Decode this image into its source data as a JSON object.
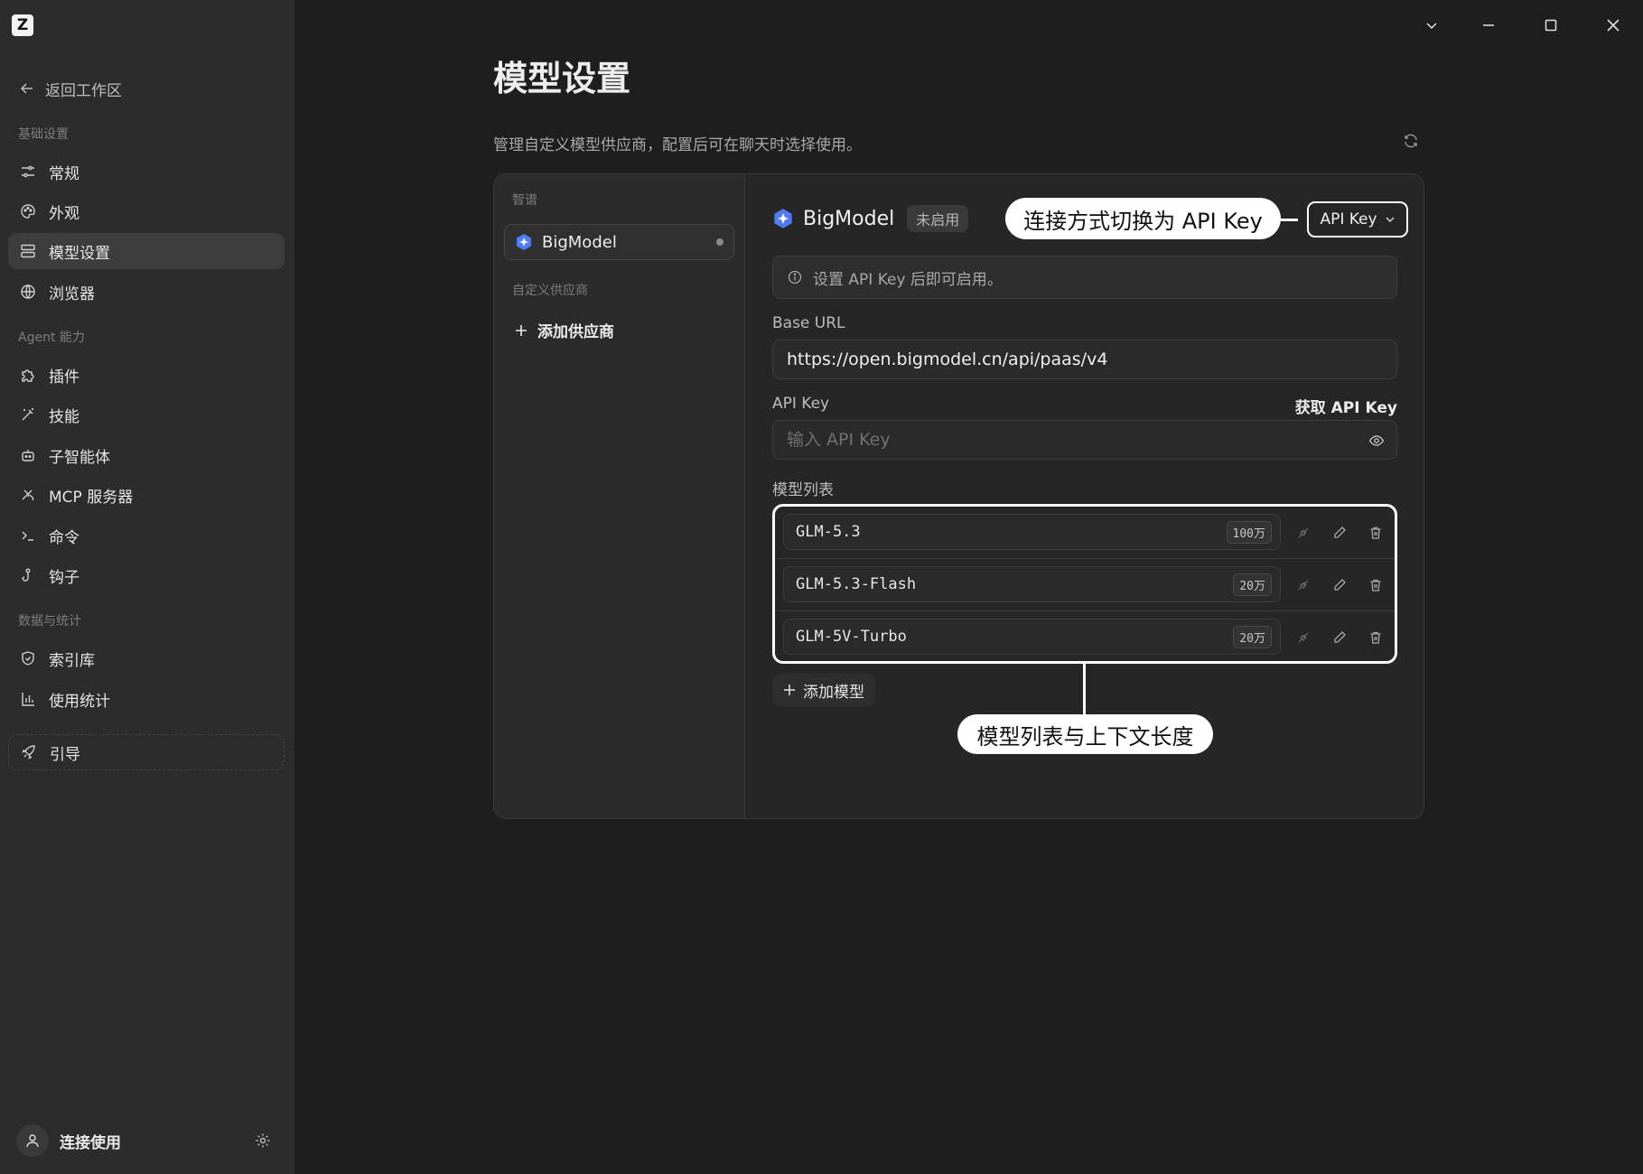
{
  "app": {
    "logo_letter": "Z"
  },
  "window_controls": [
    "chevron-down-icon",
    "minimize-icon",
    "maximize-icon",
    "close-icon"
  ],
  "sidebar": {
    "back_label": "返回工作区",
    "sections": {
      "basic": "基础设置",
      "agent": "Agent 能力",
      "data": "数据与统计"
    },
    "items": [
      {
        "label": "常规",
        "icon": "sliders-icon"
      },
      {
        "label": "外观",
        "icon": "palette-icon"
      },
      {
        "label": "模型设置",
        "icon": "layers-icon",
        "active": true
      },
      {
        "label": "浏览器",
        "icon": "globe-icon"
      },
      {
        "label": "插件",
        "icon": "puzzle-icon"
      },
      {
        "label": "技能",
        "icon": "wand-icon"
      },
      {
        "label": "子智能体",
        "icon": "bot-icon"
      },
      {
        "label": "MCP 服务器",
        "icon": "mcp-icon"
      },
      {
        "label": "命令",
        "icon": "terminal-icon"
      },
      {
        "label": "钩子",
        "icon": "hook-icon"
      },
      {
        "label": "索引库",
        "icon": "shield-icon"
      },
      {
        "label": "使用统计",
        "icon": "bar-chart-icon"
      },
      {
        "label": "引导",
        "icon": "rocket-icon"
      }
    ],
    "user": {
      "name": "连接使用"
    }
  },
  "main": {
    "title": "模型设置",
    "description": "管理自定义模型供应商，配置后可在聊天时选择使用。"
  },
  "providers": {
    "group_label": "智谱",
    "custom_label": "自定义供应商",
    "items": [
      {
        "name": "BigModel"
      }
    ],
    "add_label": "添加供应商"
  },
  "detail": {
    "provider_name": "BigModel",
    "status_badge": "未启用",
    "connection_mode": "API Key",
    "info_text": "设置 API Key 后即可启用。",
    "base_url_label": "Base URL",
    "base_url_value": "https://open.bigmodel.cn/api/paas/v4",
    "api_key_label": "API Key",
    "get_api_key_link": "获取 API Key",
    "api_key_placeholder": "输入 API Key",
    "models_label": "模型列表",
    "models": [
      {
        "name": "GLM-5.3",
        "context": "100万"
      },
      {
        "name": "GLM-5.3-Flash",
        "context": "20万"
      },
      {
        "name": "GLM-5V-Turbo",
        "context": "20万"
      }
    ],
    "add_model_label": "添加模型"
  },
  "callouts": {
    "connection": "连接方式切换为 API Key",
    "models": "模型列表与上下文长度"
  },
  "colors": {
    "sidebar_bg": "#2c2c2c",
    "main_bg": "#1e1e1e",
    "panel_bg": "#262626",
    "brand_icon": "#4f7bf7",
    "callout_bg": "#ffffff"
  }
}
